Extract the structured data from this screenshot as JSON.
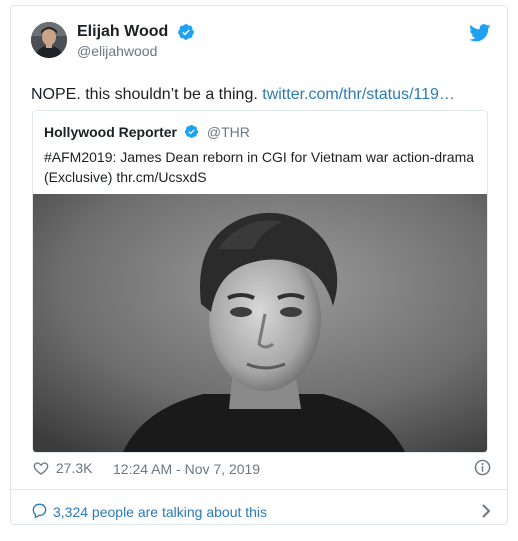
{
  "author": {
    "display_name": "Elijah Wood",
    "handle": "@elijahwood",
    "verified_icon": "verified-badge-icon",
    "avatar": "avatar"
  },
  "tweet": {
    "text": "NOPE. this shouldn’t be a thing.",
    "link_text": "twitter.com/thr/status/119…"
  },
  "quoted_tweet": {
    "display_name": "Hollywood Reporter",
    "handle": "@THR",
    "text": "#AFM2019: James Dean reborn in CGI for Vietnam war action-drama (Exclusive) thr.cm/UcsxdS"
  },
  "footer": {
    "likes": "27.3K",
    "timestamp": "12:24 AM - Nov 7, 2019"
  },
  "talking": {
    "label": "3,324 people are talking about this"
  },
  "colors": {
    "brand_blue": "#1da1f2",
    "link_blue": "#2b7bb9",
    "muted": "#697882",
    "text": "#1c2022",
    "border": "#e1e8ed"
  },
  "icons": {
    "bird": "twitter-bird-icon",
    "heart": "heart-icon",
    "info": "info-icon",
    "comment": "comment-icon",
    "chevron": "chevron-right-icon"
  }
}
